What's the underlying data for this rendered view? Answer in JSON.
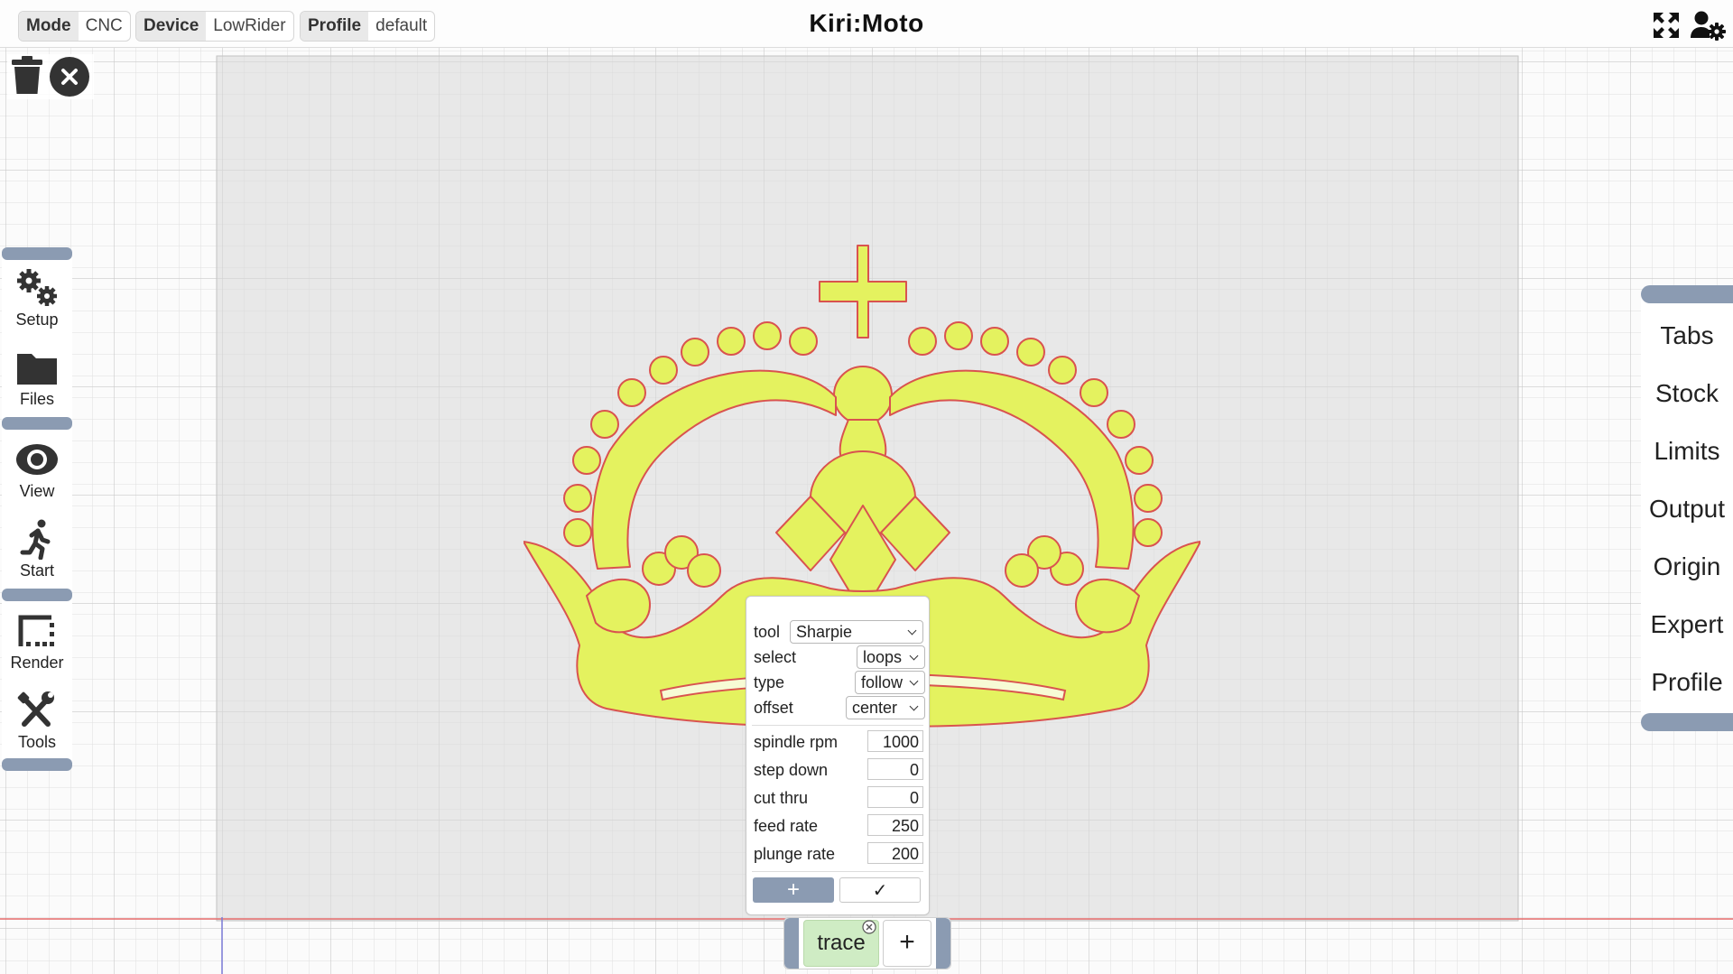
{
  "topbar": {
    "mode_key": "Mode",
    "mode_value": "CNC",
    "device_key": "Device",
    "device_value": "LowRider",
    "profile_key": "Profile",
    "profile_value": "default",
    "title": "Kiri:Moto",
    "icons": [
      "fullscreen-icon",
      "user-settings-icon"
    ]
  },
  "quick_actions": {
    "icons": [
      "trash-icon",
      "close-circle-icon"
    ]
  },
  "left_dock": {
    "items": [
      {
        "label": "Setup",
        "icon": "gears-icon"
      },
      {
        "label": "Files",
        "icon": "folder-icon"
      },
      {
        "label": "View",
        "icon": "eye-icon"
      },
      {
        "label": "Start",
        "icon": "running-person-icon"
      },
      {
        "label": "Render",
        "icon": "dotted-square-icon"
      },
      {
        "label": "Tools",
        "icon": "tools-icon"
      }
    ]
  },
  "right_dock": {
    "items": [
      "Tabs",
      "Stock",
      "Limits",
      "Output",
      "Origin",
      "Expert",
      "Profile"
    ]
  },
  "colors": {
    "part_fill": "#e4f25f",
    "part_outline": "#d9534f",
    "dock_accent": "#8b9bb2",
    "trace_bg": "#cfecc4"
  },
  "op_popup": {
    "tool_label": "tool",
    "tool_value": "Sharpie",
    "select_label": "select",
    "select_value": "loops",
    "type_label": "type",
    "type_value": "follow",
    "offset_label": "offset",
    "offset_value": "center",
    "spindle_label": "spindle rpm",
    "spindle_value": "1000",
    "stepdown_label": "step down",
    "stepdown_value": "0",
    "cutthru_label": "cut thru",
    "cutthru_value": "0",
    "feed_label": "feed rate",
    "feed_value": "250",
    "plunge_label": "plunge rate",
    "plunge_value": "200",
    "add_label": "+",
    "confirm_label": "✓"
  },
  "op_bar": {
    "trace_label": "trace",
    "add_label": "+"
  }
}
